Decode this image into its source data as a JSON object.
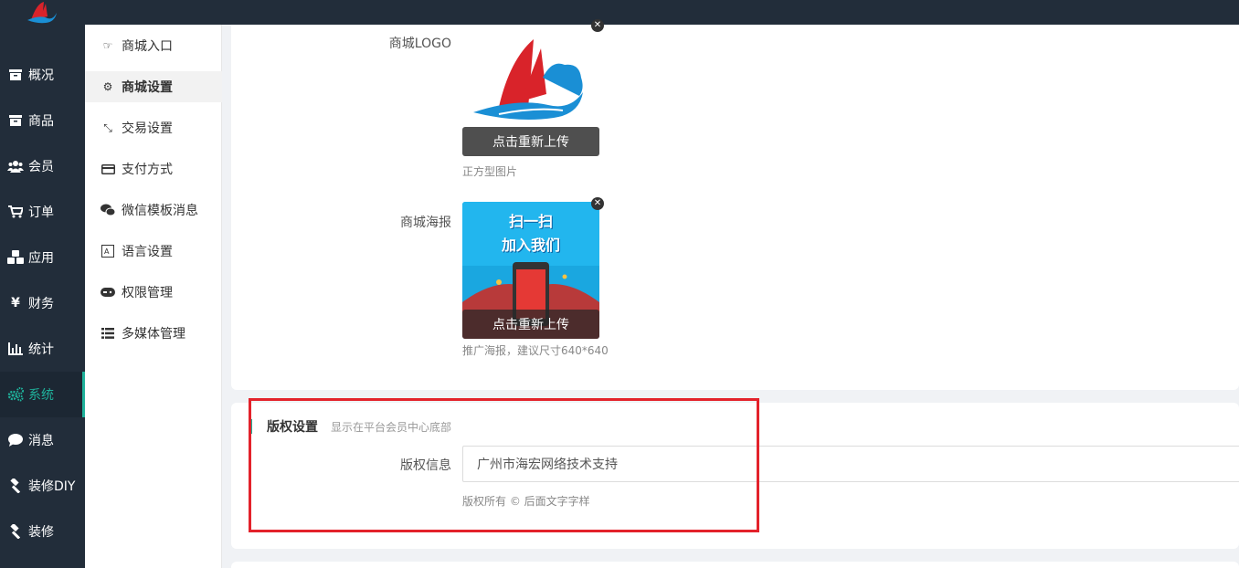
{
  "nav": [
    {
      "label": "概况",
      "icon": "archive-icon"
    },
    {
      "label": "商品",
      "icon": "archive-icon"
    },
    {
      "label": "会员",
      "icon": "users-icon"
    },
    {
      "label": "订单",
      "icon": "cart-icon"
    },
    {
      "label": "应用",
      "icon": "cubes-icon"
    },
    {
      "label": "财务",
      "icon": "yen-icon"
    },
    {
      "label": "统计",
      "icon": "bar-chart-icon"
    },
    {
      "label": "系统",
      "icon": "gears-icon",
      "active": true
    },
    {
      "label": "消息",
      "icon": "comment-icon"
    },
    {
      "label": "装修DIY",
      "icon": "gavel-icon"
    },
    {
      "label": "装修",
      "icon": "gavel-icon"
    }
  ],
  "subnav": [
    {
      "label": "商城入口",
      "icon": "hand-point-icon"
    },
    {
      "label": "商城设置",
      "icon": "gear-icon",
      "active": true
    },
    {
      "label": "交易设置",
      "icon": "compress-icon"
    },
    {
      "label": "支付方式",
      "icon": "credit-card-icon"
    },
    {
      "label": "微信模板消息",
      "icon": "wechat-icon"
    },
    {
      "label": "语言设置",
      "icon": "language-icon"
    },
    {
      "label": "权限管理",
      "icon": "gamepad-icon"
    },
    {
      "label": "多媒体管理",
      "icon": "list-icon"
    }
  ],
  "logo_section": {
    "label": "商城LOGO",
    "upload_label": "点击重新上传",
    "hint": "正方型图片"
  },
  "poster_section": {
    "label": "商城海报",
    "upload_label": "点击重新上传",
    "hint": "推广海报，建议尺寸640*640",
    "poster_text_1": "扫一扫",
    "poster_text_2": "加入我们"
  },
  "copyright": {
    "title": "版权设置",
    "desc": "显示在平台会员中心底部",
    "field_label": "版权信息",
    "field_value": "广州市海宏网络技术支持",
    "hint": "版权所有 © 后面文字字样"
  },
  "colors": {
    "sidebar_bg": "#222d3a",
    "accent": "#1fb29b",
    "highlight": "#e3222b"
  }
}
